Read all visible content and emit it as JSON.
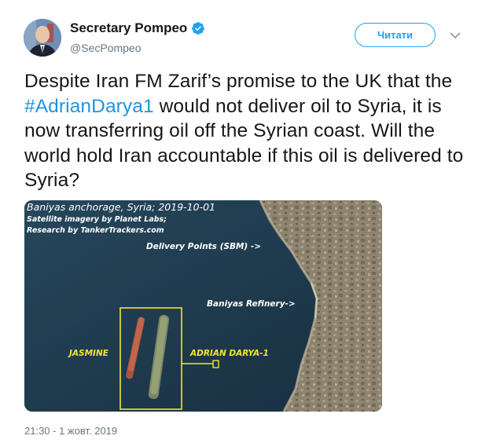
{
  "user": {
    "display_name": "Secretary Pompeo",
    "handle": "@SecPompeo",
    "verified": true,
    "avatar_icon": "profile-photo"
  },
  "follow_button": {
    "label": "Читати"
  },
  "menu": {
    "icon": "chevron-down-icon"
  },
  "tweet": {
    "text_before": "Despite Iran FM Zarif’s promise to the UK that the ",
    "hashtag": "#AdrianDarya1",
    "text_after": " would not deliver oil to Syria, it is now transferring oil off the Syrian coast. Will the world hold Iran accountable if this oil is delivered to Syria?"
  },
  "media": {
    "title": "Baniyas anchorage, Syria; 2019-10-01",
    "credit_line1": "Satellite imagery by Planet Labs;",
    "credit_line2": "Research by TankerTrackers.com",
    "label_delivery": "Delivery Points (SBM) ->",
    "label_refinery": "Baniyas Refinery->",
    "label_jasmine": "JASMINE",
    "label_adrian": "ADRIAN DARYA-1"
  },
  "timestamp": "21:30 - 1 жовт. 2019",
  "colors": {
    "accent": "#1da1f2",
    "hashtag": "#1b95e0",
    "annotation_yellow": "#f2e72a"
  }
}
